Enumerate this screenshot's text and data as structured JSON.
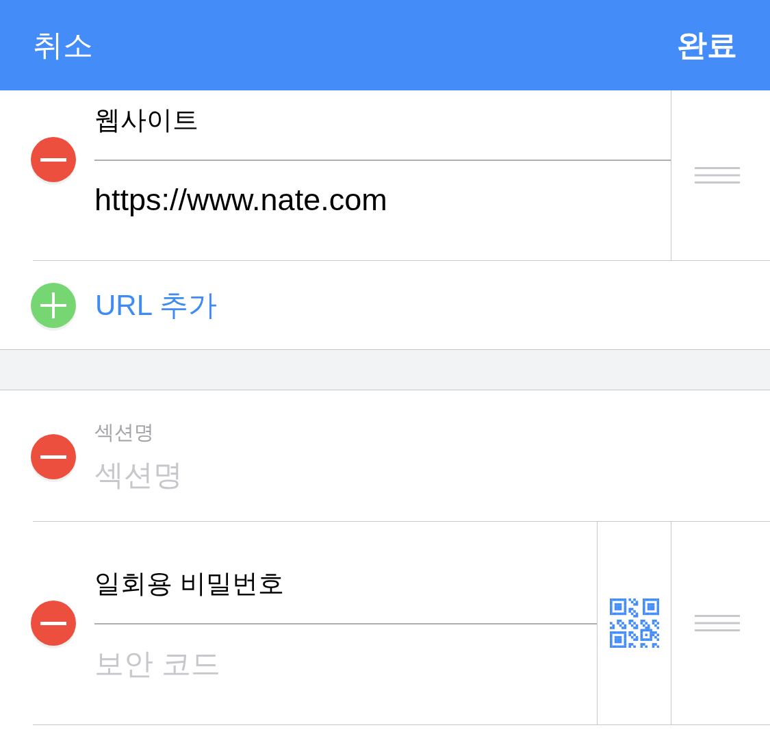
{
  "nav_bar": {
    "cancel": "취소",
    "done": "완료"
  },
  "url_section": {
    "fields": [
      {
        "kind": "url",
        "label": "웹사이트",
        "value": "https://www.nate.com"
      }
    ],
    "add_button": "URL 추가"
  },
  "custom_section": {
    "name_field": {
      "label": "섹션명",
      "placeholder": "섹션명"
    },
    "fields": [
      {
        "kind": "otp",
        "label": "일회용 비밀번호",
        "placeholder": "보안 코드"
      }
    ]
  }
}
